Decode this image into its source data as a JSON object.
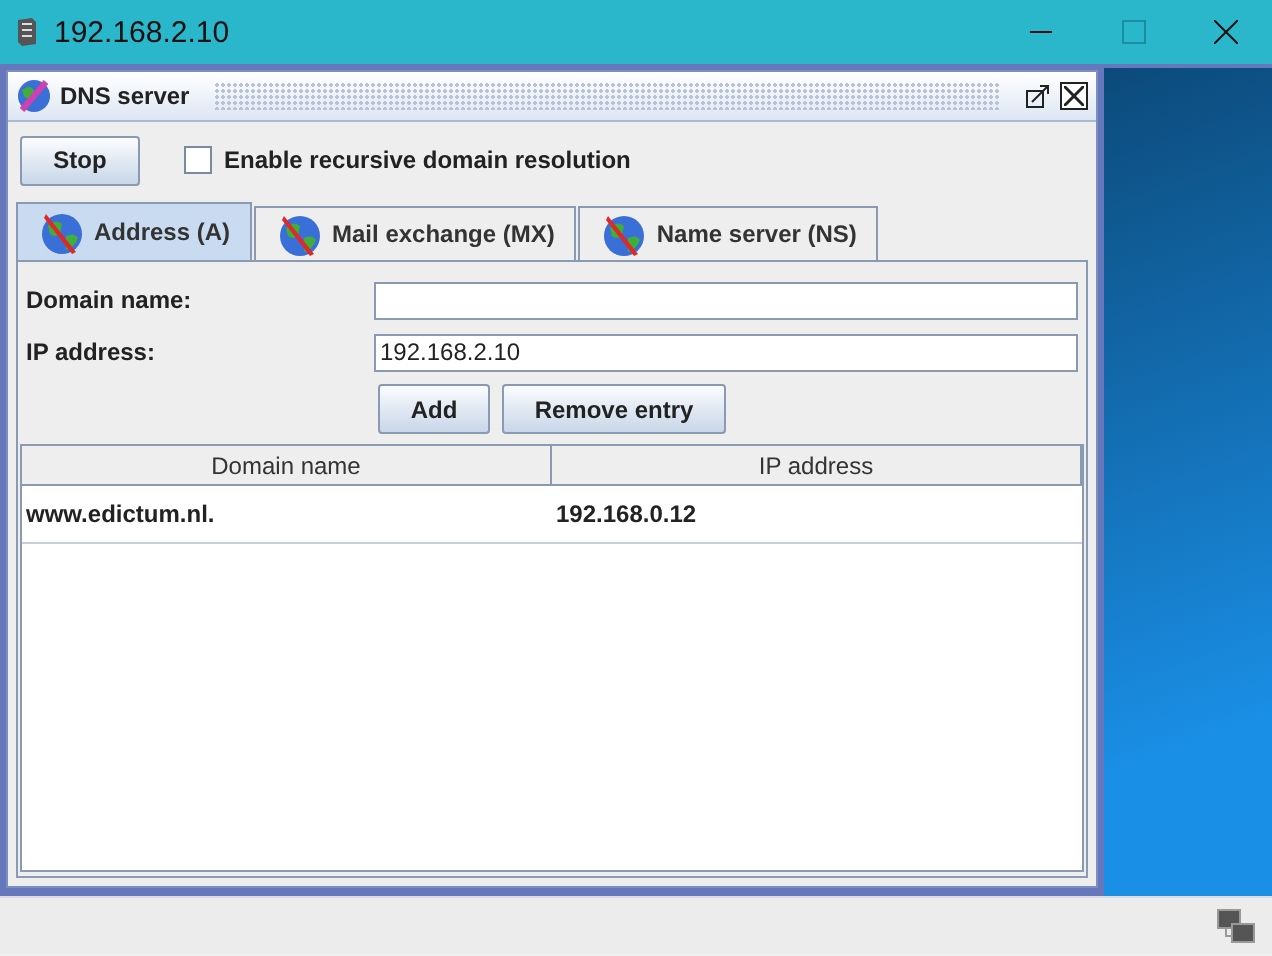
{
  "window": {
    "title": "192.168.2.10"
  },
  "internal_frame": {
    "title": "DNS server"
  },
  "toolbar": {
    "stop_button": "Stop",
    "recursive_checkbox": {
      "label": "Enable recursive domain resolution",
      "checked": false
    }
  },
  "tabs": [
    {
      "label": "Address (A)",
      "selected": true
    },
    {
      "label": "Mail exchange (MX)",
      "selected": false
    },
    {
      "label": "Name server (NS)",
      "selected": false
    }
  ],
  "form": {
    "fields": [
      {
        "label": "Domain name:"
      },
      {
        "label": "IP address:",
        "value": "192.168.2.10"
      }
    ],
    "buttons": [
      "Add",
      "Remove entry"
    ]
  },
  "table": {
    "columns": [
      "Domain name",
      "IP address"
    ],
    "rows": [
      [
        "www.edictum.nl.",
        "192.168.0.12"
      ]
    ]
  }
}
